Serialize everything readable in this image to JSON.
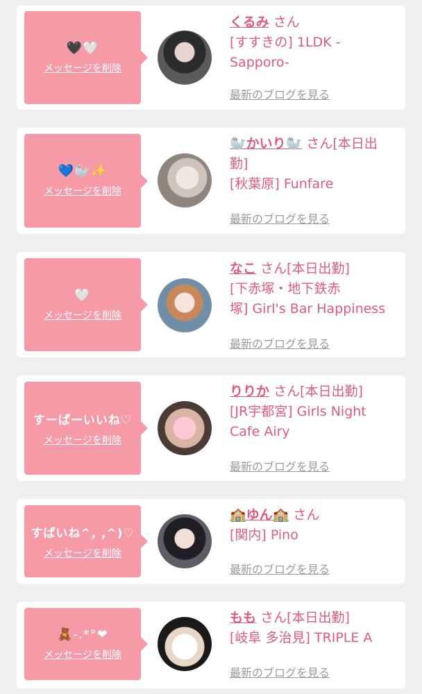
{
  "colors": {
    "accent": "#e15b79",
    "bubble": "#f79aa8",
    "muted": "#9b9b9b"
  },
  "delete_label": "メッセージを削除",
  "blog_label": "最新のブログを見る",
  "items": [
    {
      "message": "🖤🤍",
      "name": "くるみ",
      "suffix": "さん",
      "shop_lines": [
        "[すすきの] 1LDK -",
        "Sapporo-"
      ]
    },
    {
      "message": "💙🦭✨",
      "name": "🦭かいり🦭",
      "suffix": "さん[本日出",
      "shop_lines": [
        "勤]",
        "[秋葉原] Funfare"
      ]
    },
    {
      "message": "🤍",
      "name": "なこ",
      "suffix": "さん[本日出勤]",
      "shop_lines": [
        "[下赤塚・地下鉄赤",
        "塚] Girl's Bar Happiness"
      ]
    },
    {
      "message": "すーぱーいいね♡",
      "name": "りりか",
      "suffix": "さん[本日出勤]",
      "shop_lines": [
        "[JR宇都宮] Girls Night",
        "Cafe Airy"
      ]
    },
    {
      "message": "すぱいね^, ,^)♡",
      "name": "🏫ゆん🏫",
      "suffix": "さん",
      "shop_lines": [
        "[関内] Pino"
      ]
    },
    {
      "message": "🧸-.*°❤",
      "name": "もも",
      "suffix": "さん[本日出勤]",
      "shop_lines": [
        "[岐阜 多治見] TRIPLE A"
      ]
    }
  ]
}
